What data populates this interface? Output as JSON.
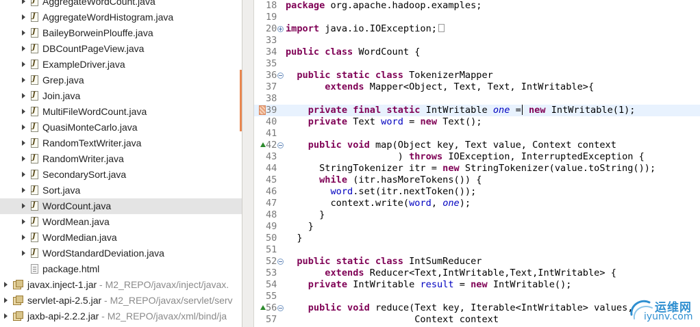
{
  "explorer": {
    "items": [
      {
        "kind": "java",
        "label": "AggregateWordCount.java"
      },
      {
        "kind": "java",
        "label": "AggregateWordHistogram.java"
      },
      {
        "kind": "java",
        "label": "BaileyBorweinPlouffe.java"
      },
      {
        "kind": "java",
        "label": "DBCountPageView.java"
      },
      {
        "kind": "java",
        "label": "ExampleDriver.java"
      },
      {
        "kind": "java",
        "label": "Grep.java"
      },
      {
        "kind": "java",
        "label": "Join.java"
      },
      {
        "kind": "java",
        "label": "MultiFileWordCount.java"
      },
      {
        "kind": "java",
        "label": "QuasiMonteCarlo.java"
      },
      {
        "kind": "java",
        "label": "RandomTextWriter.java"
      },
      {
        "kind": "java",
        "label": "RandomWriter.java"
      },
      {
        "kind": "java",
        "label": "SecondarySort.java"
      },
      {
        "kind": "java",
        "label": "Sort.java"
      },
      {
        "kind": "java",
        "label": "WordCount.java",
        "selected": true
      },
      {
        "kind": "java",
        "label": "WordMean.java"
      },
      {
        "kind": "java",
        "label": "WordMedian.java"
      },
      {
        "kind": "java",
        "label": "WordStandardDeviation.java"
      },
      {
        "kind": "html",
        "label": "package.html"
      }
    ],
    "jars": [
      {
        "label": "javax.inject-1.jar",
        "path": " - M2_REPO/javax/inject/javax."
      },
      {
        "label": "servlet-api-2.5.jar",
        "path": " - M2_REPO/javax/servlet/serv"
      },
      {
        "label": "jaxb-api-2.2.2.jar",
        "path": " - M2_REPO/javax/xml/bind/ja"
      }
    ]
  },
  "editor": {
    "lines": [
      {
        "n": "18",
        "code": "package org.apache.hadoop.examples;"
      },
      {
        "n": "19",
        "code": ""
      },
      {
        "n": "20",
        "code": "import java.io.IOException;"
      },
      {
        "n": "33",
        "code": ""
      },
      {
        "n": "34",
        "code": "public class WordCount {"
      },
      {
        "n": "35",
        "code": ""
      },
      {
        "n": "36",
        "code": "  public static class TokenizerMapper"
      },
      {
        "n": "37",
        "code": "       extends Mapper<Object, Text, Text, IntWritable>{"
      },
      {
        "n": "38",
        "code": ""
      },
      {
        "n": "39",
        "code": "    private final static IntWritable one = new IntWritable(1);"
      },
      {
        "n": "40",
        "code": "    private Text word = new Text();"
      },
      {
        "n": "41",
        "code": ""
      },
      {
        "n": "42",
        "code": "    public void map(Object key, Text value, Context context"
      },
      {
        "n": "43",
        "code": "                    ) throws IOException, InterruptedException {"
      },
      {
        "n": "44",
        "code": "      StringTokenizer itr = new StringTokenizer(value.toString());"
      },
      {
        "n": "45",
        "code": "      while (itr.hasMoreTokens()) {"
      },
      {
        "n": "46",
        "code": "        word.set(itr.nextToken());"
      },
      {
        "n": "47",
        "code": "        context.write(word, one);"
      },
      {
        "n": "48",
        "code": "      }"
      },
      {
        "n": "49",
        "code": "    }"
      },
      {
        "n": "50",
        "code": "  }"
      },
      {
        "n": "51",
        "code": ""
      },
      {
        "n": "52",
        "code": "  public static class IntSumReducer"
      },
      {
        "n": "53",
        "code": "       extends Reducer<Text,IntWritable,Text,IntWritable> {"
      },
      {
        "n": "54",
        "code": "    private IntWritable result = new IntWritable();"
      },
      {
        "n": "55",
        "code": ""
      },
      {
        "n": "56",
        "code": "    public void reduce(Text key, Iterable<IntWritable> values,"
      },
      {
        "n": "57",
        "code": "                       Context context"
      }
    ],
    "tokens": {
      "kw": [
        "package",
        "import",
        "public",
        "class",
        "static",
        "extends",
        "private",
        "final",
        "new",
        "void",
        "throws",
        "while"
      ],
      "fields": [
        "one",
        "word",
        "result"
      ],
      "italic_fields": [
        "one"
      ]
    }
  },
  "watermark": {
    "cn": "运维网",
    "url": "iyunv.com"
  },
  "colors": {
    "keyword": "#7f0055",
    "field": "#0000c0",
    "current_line": "#e8f2fe",
    "selection": "#e4e4e4",
    "watermark": "#2f8fd0"
  }
}
